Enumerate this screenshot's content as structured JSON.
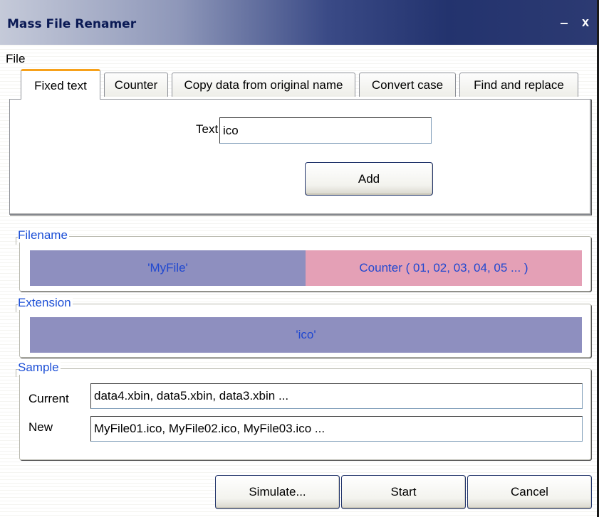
{
  "window": {
    "title": "Mass File Renamer",
    "minimize_glyph": "‒",
    "close_glyph": "x"
  },
  "menu": {
    "file_label": "File"
  },
  "tabs": [
    {
      "label": "Fixed text",
      "active": true
    },
    {
      "label": "Counter",
      "active": false
    },
    {
      "label": "Copy data from original name",
      "active": false
    },
    {
      "label": "Convert case",
      "active": false
    },
    {
      "label": "Find and replace",
      "active": false
    }
  ],
  "fixed_text": {
    "text_label": "Text",
    "text_value": "ico",
    "add_label": "Add"
  },
  "filename": {
    "legend": "Filename",
    "segments": [
      {
        "label": "'MyFile'",
        "color": "#8e8fbf"
      },
      {
        "label": "Counter ( 01, 02, 03, 04, 05 ... )",
        "color": "#e4a0b6"
      }
    ]
  },
  "extension": {
    "legend": "Extension",
    "segments": [
      {
        "label": "'ico'",
        "color": "#8e8fbf"
      }
    ]
  },
  "sample": {
    "legend": "Sample",
    "current_label": "Current",
    "current_value": "data4.xbin, data5.xbin, data3.xbin ...",
    "new_label": "New",
    "new_value": "MyFile01.ico, MyFile02.ico, MyFile03.ico ..."
  },
  "buttons": {
    "simulate_label": "Simulate...",
    "start_label": "Start",
    "cancel_label": "Cancel"
  },
  "colors": {
    "legend_text": "#1c4fd6",
    "active_tab_accent": "#f7a11a"
  }
}
